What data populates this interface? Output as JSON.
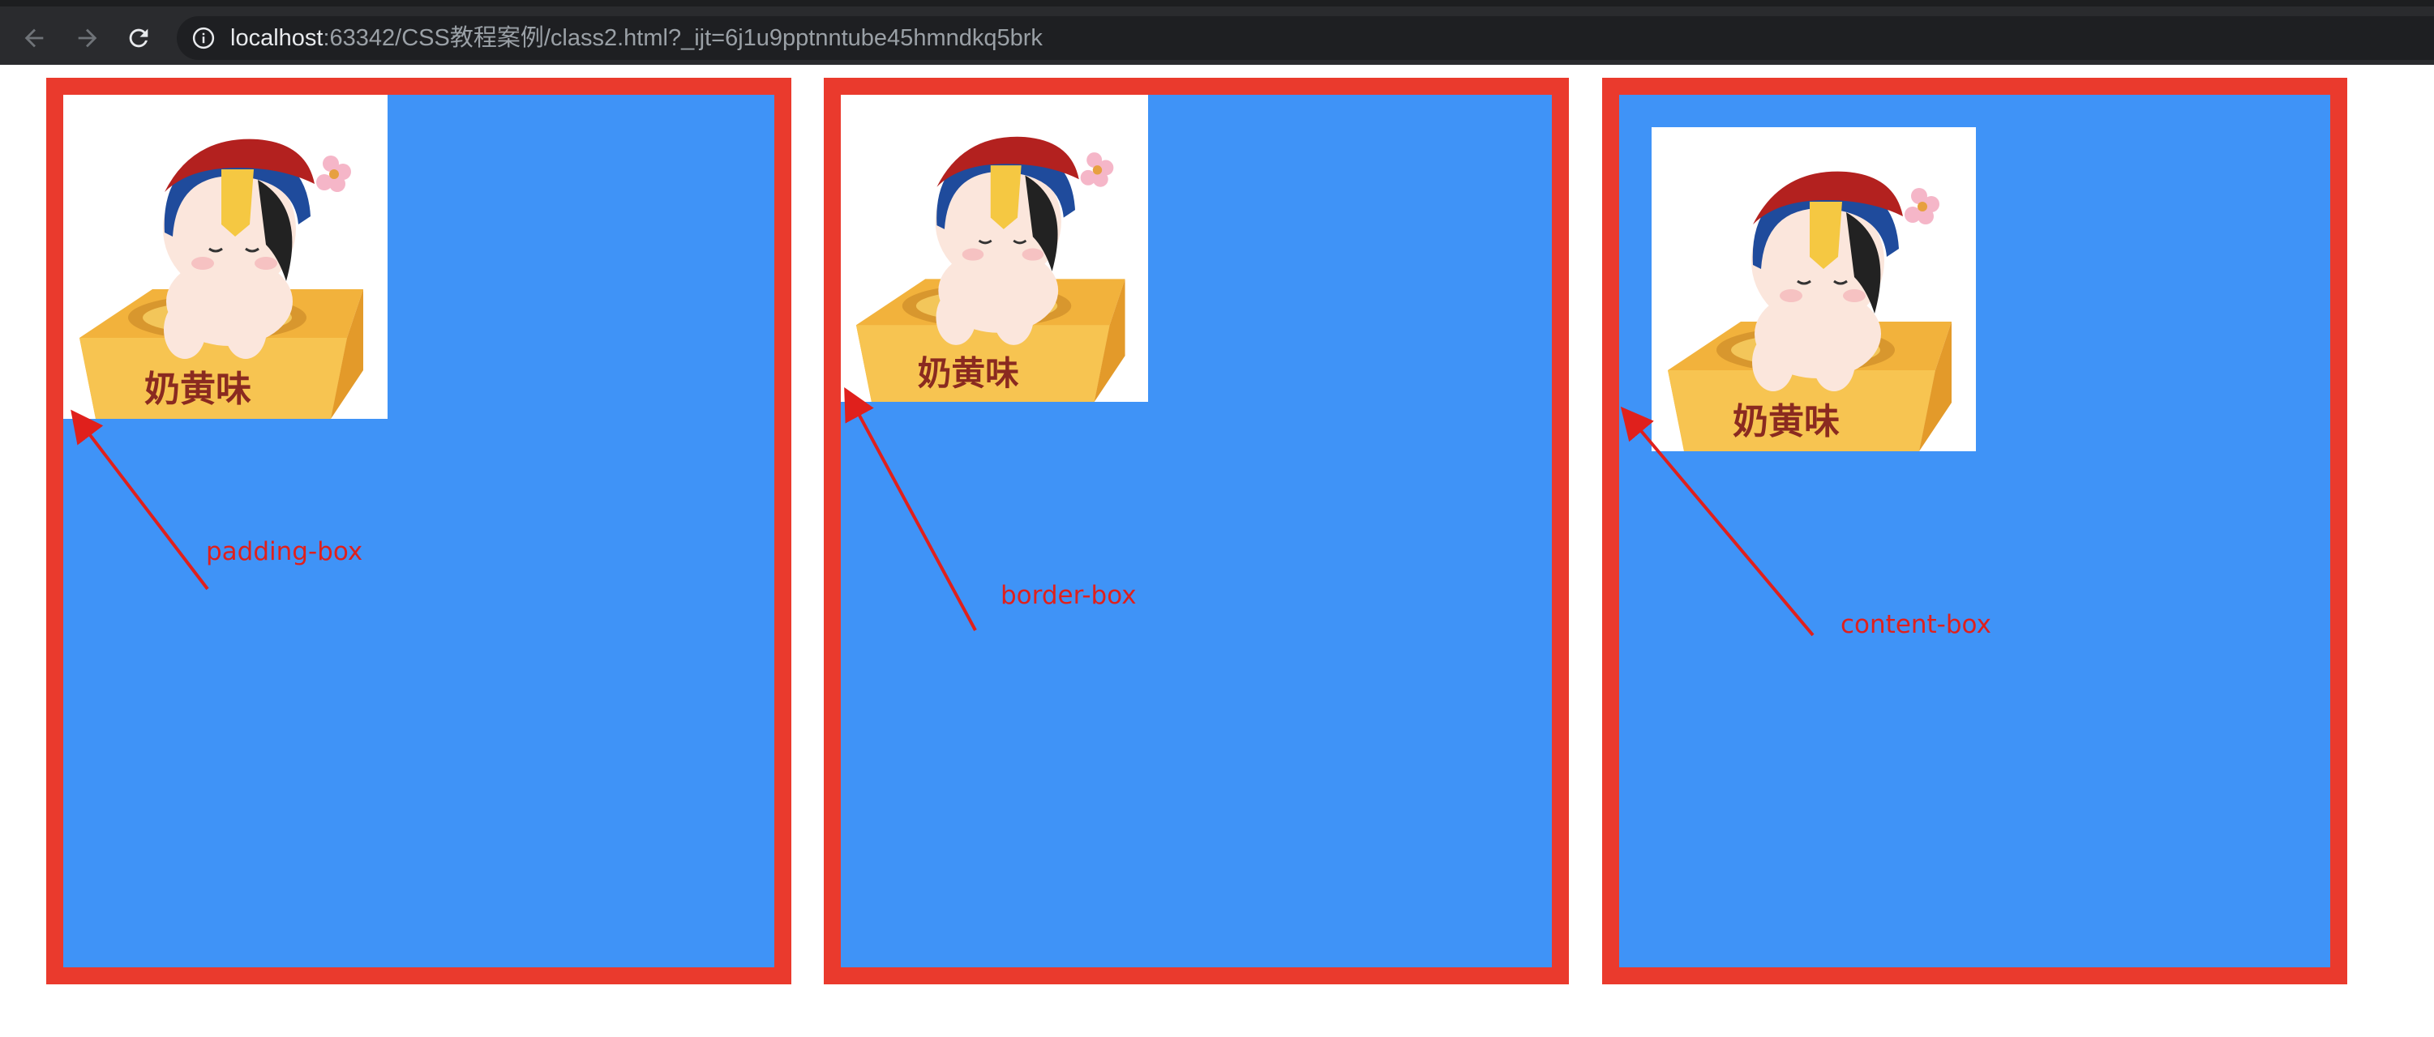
{
  "browser": {
    "url_host": "localhost",
    "url_rest": ":63342/CSS教程案例/class2.html?_ijt=6j1u9pptnntube45hmndkq5brk",
    "icons": {
      "back": "arrow-left-icon",
      "forward": "arrow-right-icon",
      "reload": "reload-icon",
      "site_info": "info-icon"
    }
  },
  "page": {
    "colors": {
      "border": "#ea3a2d",
      "background": "#3f93f7",
      "annotation": "#e0201c"
    },
    "boxes": [
      {
        "caption": "padding-box",
        "image_text": "奶黄味"
      },
      {
        "caption": "border-box",
        "image_text": "奶黄味"
      },
      {
        "caption": "content-box",
        "image_text": "奶黄味"
      }
    ]
  }
}
